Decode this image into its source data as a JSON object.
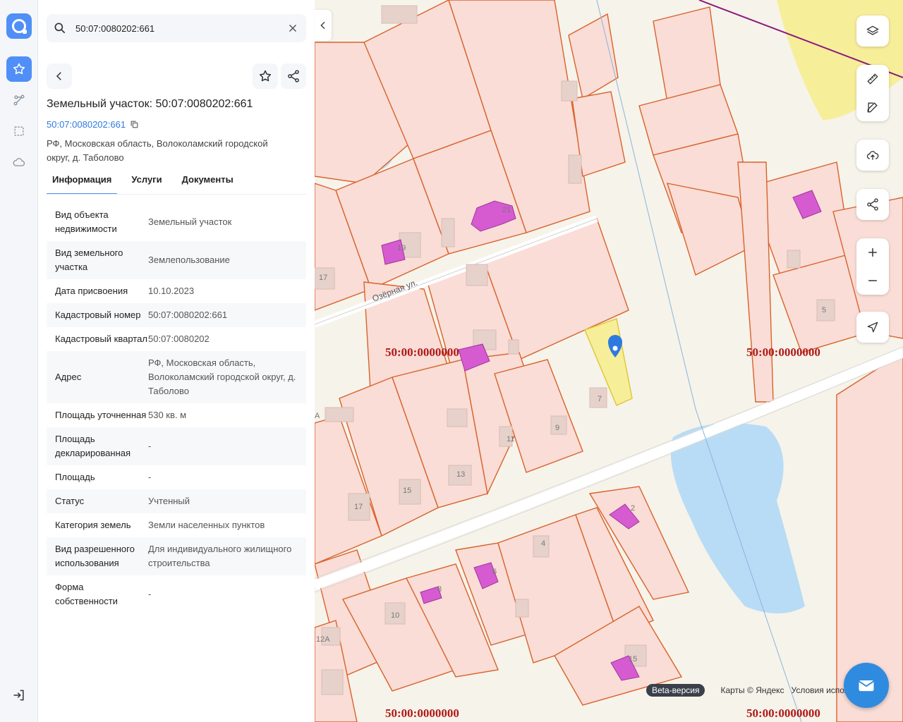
{
  "search": {
    "value": "50:07:0080202:661"
  },
  "object": {
    "title": "Земельный участок: 50:07:0080202:661",
    "cad_link": "50:07:0080202:661",
    "address": "РФ, Московская область, Волоколамский городской округ, д. Таболово"
  },
  "tabs": [
    "Информация",
    "Услуги",
    "Документы"
  ],
  "properties": [
    {
      "key": "Вид объекта недвижимости",
      "value": "Земельный участок"
    },
    {
      "key": "Вид земельного участка",
      "value": "Землепользование"
    },
    {
      "key": "Дата присвоения",
      "value": "10.10.2023"
    },
    {
      "key": "Кадастровый номер",
      "value": "50:07:0080202:661"
    },
    {
      "key": "Кадастровый квартал",
      "value": "50:07:0080202"
    },
    {
      "key": "Адрес",
      "value": "РФ, Московская область, Волоколамский городской округ, д. Таболово"
    },
    {
      "key": "Площадь уточненная",
      "value": "530 кв. м"
    },
    {
      "key": "Площадь декларированная",
      "value": "-"
    },
    {
      "key": "Площадь",
      "value": "-"
    },
    {
      "key": "Статус",
      "value": "Учтенный"
    },
    {
      "key": "Категория земель",
      "value": "Земли населенных пунктов"
    },
    {
      "key": "Вид разрешенного использования",
      "value": "Для индивидуального жилищного строительства"
    },
    {
      "key": "Форма собственности",
      "value": "-"
    }
  ],
  "map": {
    "street": "Озёрная ул.",
    "quarter_label": "50:00:0000000",
    "house_numbers": [
      "21",
      "19",
      "17",
      "7",
      "9",
      "11",
      "13",
      "15",
      "17",
      "5",
      "4",
      "6",
      "8",
      "10",
      "12А",
      "15",
      "2",
      "А"
    ],
    "beta": "Beta-версия",
    "copyright": "Карты © Яндекс",
    "terms": "Условия испол"
  },
  "colors": {
    "accent": "#4f8ff7",
    "parcel_border": "#d9622b",
    "parcel_fill": "#f9ddd6",
    "selected_fill": "#f7ee9a",
    "building": "#d65bd1",
    "water": "#b8dcf5"
  }
}
